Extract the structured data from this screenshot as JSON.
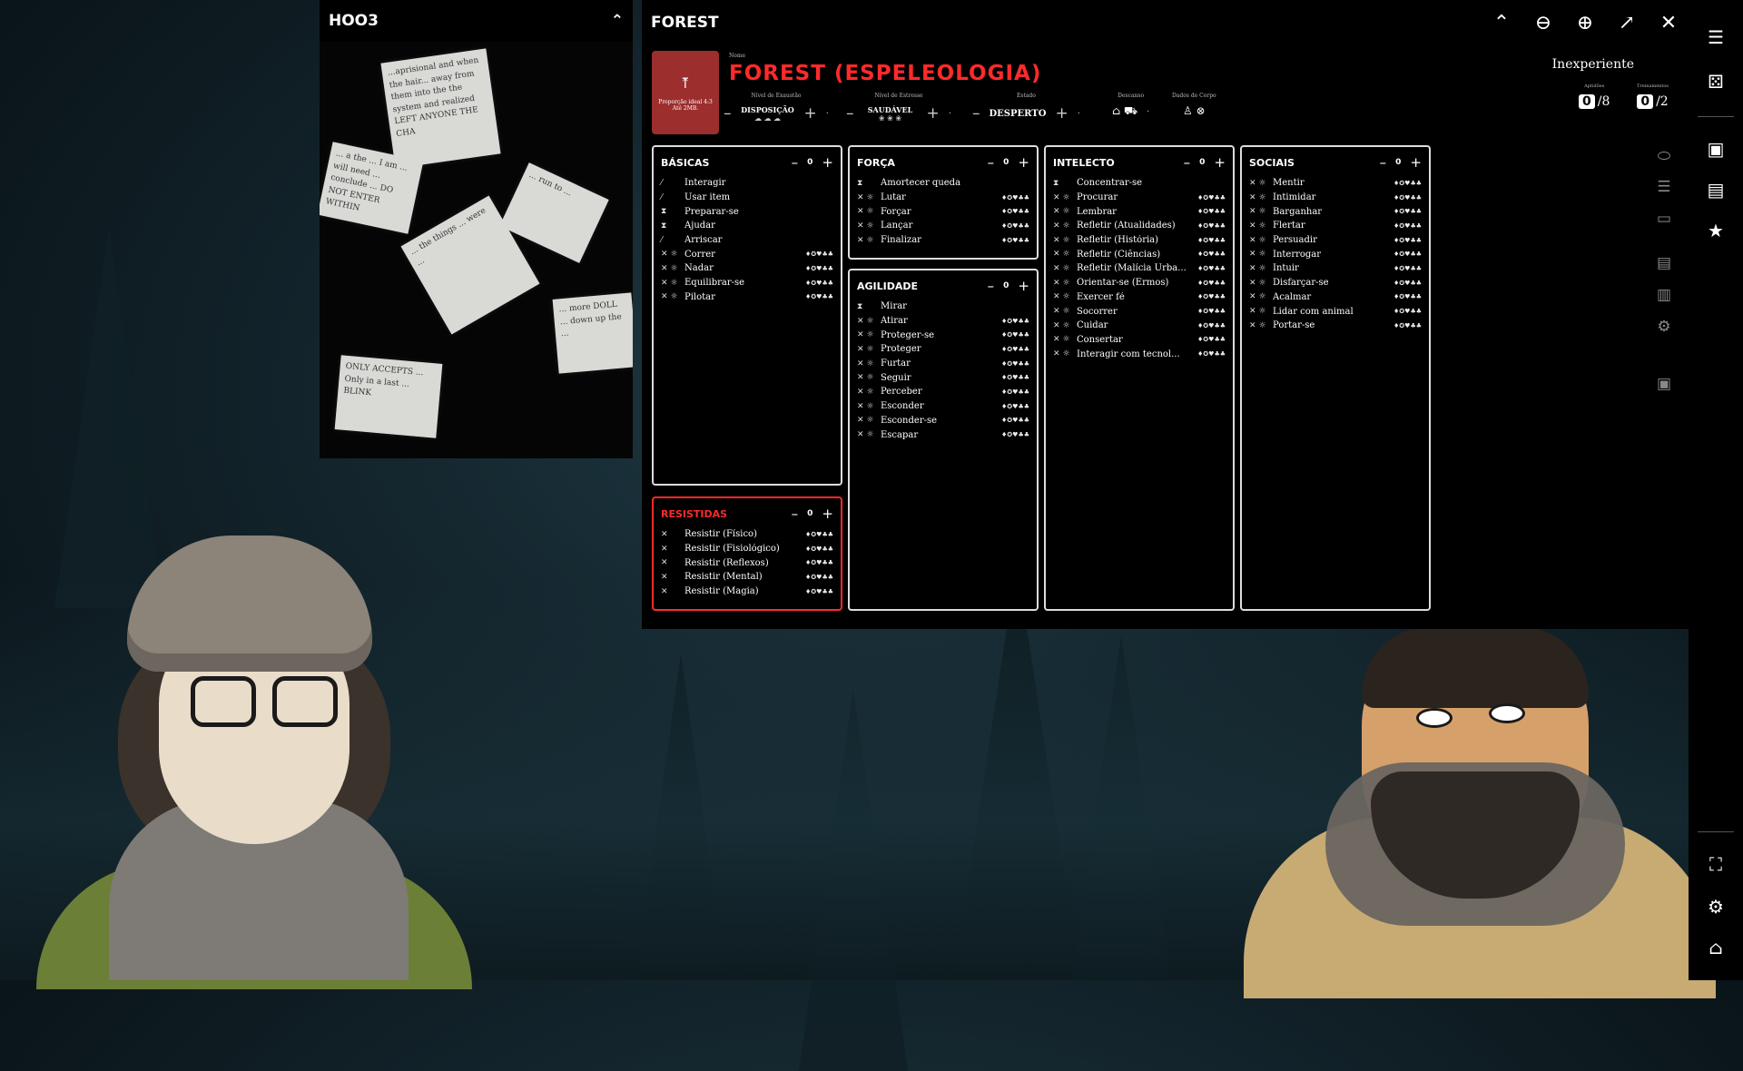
{
  "left_panel": {
    "title": "HOO3",
    "notes": [
      "...aprisional and when the hair... away from them into the the system and realized LEFT ANYONE THE CHA",
      "... a the ... I am ... will need ... conclude ... DO NOT ENTER WITHIN",
      "... the things ... were ...",
      "... run to ... ",
      "... more DOLL ... down up the ... ",
      "ONLY ACCEPTS ... Only in a last ... BLINK"
    ]
  },
  "forest": {
    "title": "FOREST",
    "upload_text": "Proporção ideal 4:3\nAté 2MB.",
    "name_label": "Nome",
    "character_name": "FOREST (ESPELEOLOGIA)",
    "meters": [
      {
        "label": "Nível de Exaustão",
        "value": "DISPOSIÇÃO",
        "icons": "☁ ☁ ☁"
      },
      {
        "label": "Nível de Estresse",
        "value": "SAUDÁVEL",
        "icons": "❀ ❀ ❀"
      },
      {
        "label": "Estado",
        "value": "DESPERTO",
        "icons": ""
      }
    ],
    "rest_label": "Descanso",
    "body_dice_label": "Dados de Corpo",
    "rank": "Inexperiente",
    "aptitudes": {
      "label": "Aptidões",
      "value": "0",
      "max": "/8"
    },
    "trainings": {
      "label": "Treinamentos",
      "value": "0",
      "max": "/2"
    }
  },
  "skill_groups": [
    {
      "title": "BÁSICAS",
      "value": "0",
      "skills": [
        {
          "icon": "⁄",
          "name": "Interagir",
          "dice": ""
        },
        {
          "icon": "⁄",
          "name": "Usar item",
          "dice": ""
        },
        {
          "icon": "⧗",
          "name": "Preparar-se",
          "dice": ""
        },
        {
          "icon": "⧗",
          "name": "Ajudar",
          "dice": ""
        },
        {
          "icon": "⁄",
          "name": "Arriscar",
          "dice": ""
        },
        {
          "icon": "✕ ☼",
          "name": "Correr",
          "dice": "♦✪♥♣♣"
        },
        {
          "icon": "✕ ☼",
          "name": "Nadar",
          "dice": "♦✪♥♣♣"
        },
        {
          "icon": "✕ ☼",
          "name": "Equilibrar-se",
          "dice": "♦✪♥♣♣"
        },
        {
          "icon": "✕ ☼",
          "name": "Pilotar",
          "dice": "♦✪♥♣♣"
        }
      ]
    },
    {
      "title": "FORÇA",
      "value": "0",
      "skills": [
        {
          "icon": "⧗",
          "name": "Amortecer queda",
          "dice": ""
        },
        {
          "icon": "✕ ☼",
          "name": "Lutar",
          "dice": "♦✪♥♣♣"
        },
        {
          "icon": "✕ ☼",
          "name": "Forçar",
          "dice": "♦✪♥♣♣"
        },
        {
          "icon": "✕ ☼",
          "name": "Lançar",
          "dice": "♦✪♥♣♣"
        },
        {
          "icon": "✕ ☼",
          "name": "Finalizar",
          "dice": "♦✪♥♣♣"
        }
      ]
    },
    {
      "title": "AGILIDADE",
      "value": "0",
      "skills": [
        {
          "icon": "⧗",
          "name": "Mirar",
          "dice": ""
        },
        {
          "icon": "✕ ☼",
          "name": "Atirar",
          "dice": "♦✪♥♣♣"
        },
        {
          "icon": "✕ ☼",
          "name": "Proteger-se",
          "dice": "♦✪♥♣♣"
        },
        {
          "icon": "✕ ☼",
          "name": "Proteger",
          "dice": "♦✪♥♣♣"
        },
        {
          "icon": "✕ ☼",
          "name": "Furtar",
          "dice": "♦✪♥♣♣"
        },
        {
          "icon": "✕ ☼",
          "name": "Seguir",
          "dice": "♦✪♥♣♣"
        },
        {
          "icon": "✕ ☼",
          "name": "Perceber",
          "dice": "♦✪♥♣♣"
        },
        {
          "icon": "✕ ☼",
          "name": "Esconder",
          "dice": "♦✪♥♣♣"
        },
        {
          "icon": "✕ ☼",
          "name": "Esconder-se",
          "dice": "♦✪♥♣♣"
        },
        {
          "icon": "✕ ☼",
          "name": "Escapar",
          "dice": "♦✪♥♣♣"
        }
      ]
    },
    {
      "title": "INTELECTO",
      "value": "0",
      "skills": [
        {
          "icon": "⧗",
          "name": "Concentrar-se",
          "dice": ""
        },
        {
          "icon": "✕ ☼",
          "name": "Procurar",
          "dice": "♦✪♥♣♣"
        },
        {
          "icon": "✕ ☼",
          "name": "Lembrar",
          "dice": "♦✪♥♣♣"
        },
        {
          "icon": "✕ ☼",
          "name": "Refletir (Atualidades)",
          "dice": "♦✪♥♣♣"
        },
        {
          "icon": "✕ ☼",
          "name": "Refletir (História)",
          "dice": "♦✪♥♣♣"
        },
        {
          "icon": "✕ ☼",
          "name": "Refletir (Ciências)",
          "dice": "♦✪♥♣♣"
        },
        {
          "icon": "✕ ☼",
          "name": "Refletir (Malícia Urba...",
          "dice": "♦✪♥♣♣"
        },
        {
          "icon": "✕ ☼",
          "name": "Orientar-se (Ermos)",
          "dice": "♦✪♥♣♣"
        },
        {
          "icon": "✕ ☼",
          "name": "Exercer fé",
          "dice": "♦✪♥♣♣"
        },
        {
          "icon": "✕ ☼",
          "name": "Socorrer",
          "dice": "♦✪♥♣♣"
        },
        {
          "icon": "✕ ☼",
          "name": "Cuidar",
          "dice": "♦✪♥♣♣"
        },
        {
          "icon": "✕ ☼",
          "name": "Consertar",
          "dice": "♦✪♥♣♣"
        },
        {
          "icon": "✕ ☼",
          "name": "Interagir com tecnol...",
          "dice": "♦✪♥♣♣"
        }
      ]
    },
    {
      "title": "SOCIAIS",
      "value": "0",
      "skills": [
        {
          "icon": "✕ ☼",
          "name": "Mentir",
          "dice": "♦✪♥♣♣"
        },
        {
          "icon": "✕ ☼",
          "name": "Intimidar",
          "dice": "♦✪♥♣♣"
        },
        {
          "icon": "✕ ☼",
          "name": "Barganhar",
          "dice": "♦✪♥♣♣"
        },
        {
          "icon": "✕ ☼",
          "name": "Flertar",
          "dice": "♦✪♥♣♣"
        },
        {
          "icon": "✕ ☼",
          "name": "Persuadir",
          "dice": "♦✪♥♣♣"
        },
        {
          "icon": "✕ ☼",
          "name": "Interrogar",
          "dice": "♦✪♥♣♣"
        },
        {
          "icon": "✕ ☼",
          "name": "Intuir",
          "dice": "♦✪♥♣♣"
        },
        {
          "icon": "✕ ☼",
          "name": "Disfarçar-se",
          "dice": "♦✪♥♣♣"
        },
        {
          "icon": "✕ ☼",
          "name": "Acalmar",
          "dice": "♦✪♥♣♣"
        },
        {
          "icon": "✕ ☼",
          "name": "Lidar com animal",
          "dice": "♦✪♥♣♣"
        },
        {
          "icon": "✕ ☼",
          "name": "Portar-se",
          "dice": "♦✪♥♣♣"
        }
      ]
    },
    {
      "title": "RESISTIDAS",
      "value": "0",
      "skills": [
        {
          "icon": "✕",
          "name": "Resistir (Físico)",
          "dice": "♦✪♥♣♣"
        },
        {
          "icon": "✕",
          "name": "Resistir (Fisiológico)",
          "dice": "♦✪♥♣♣"
        },
        {
          "icon": "✕",
          "name": "Resistir (Reflexos)",
          "dice": "♦✪♥♣♣"
        },
        {
          "icon": "✕",
          "name": "Resistir (Mental)",
          "dice": "♦✪♥♣♣"
        },
        {
          "icon": "✕",
          "name": "Resistir (Magia)",
          "dice": "♦✪♥♣♣"
        }
      ]
    }
  ],
  "colors": {
    "accent_red": "#ff2a2a",
    "panel_bg": "#000000",
    "upload_bg": "#9c2e2e"
  }
}
